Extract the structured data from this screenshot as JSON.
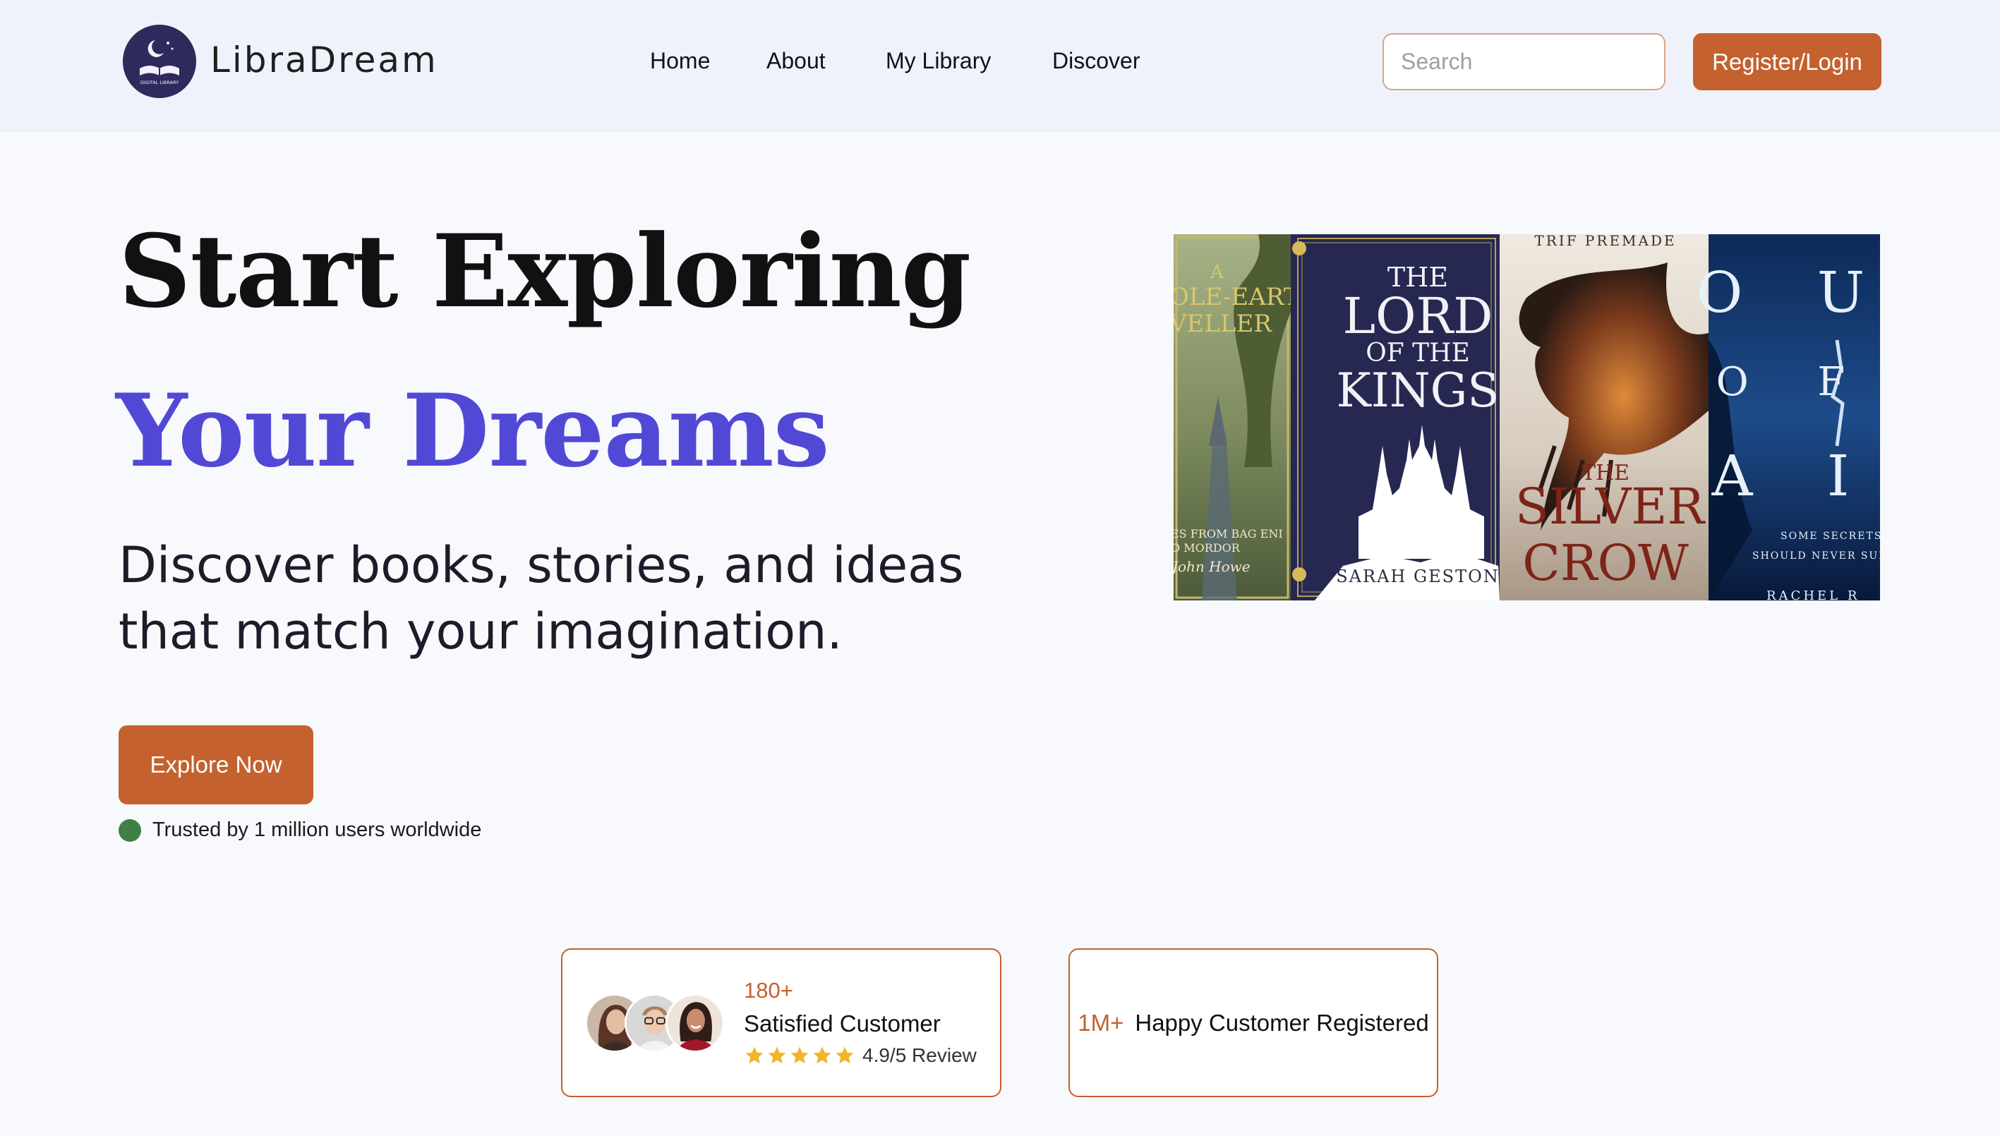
{
  "header": {
    "brand": "LibraDream",
    "logo_text": "DIGITAL LIBRARY",
    "nav": {
      "home": "Home",
      "about": "About",
      "my_library": "My Library",
      "discover": "Discover"
    },
    "search": {
      "placeholder": "Search",
      "value": ""
    },
    "login_label": "Register/Login"
  },
  "hero": {
    "line1": "Start Exploring",
    "line2": "Your Dreams",
    "subtitle": "Discover books, stories, and ideas that match your imagination.",
    "cta_label": "Explore Now",
    "trusted_text": "Trusted by 1 million users worldwide"
  },
  "banner": {
    "book1": {
      "title_lines": [
        "A",
        "OLE-EART",
        "VELLER"
      ],
      "footer_lines": [
        "ES FROM BAG ENI",
        "O MORDOR"
      ],
      "author": "John Howe"
    },
    "book2": {
      "title_the": "THE",
      "title_lord": "LORD",
      "title_of": "OF THE",
      "title_kings": "KINGS",
      "author": "SARAH GESTON"
    },
    "book3": {
      "top": "TRIF PREMADE",
      "title_the": "THE",
      "title_silver": "SILVER",
      "title_crow": "CROW"
    },
    "book4": {
      "letters_row1": "O U",
      "letters_row2": "O F",
      "letters_row3": "A I",
      "tag1": "SOME SECRETS",
      "tag2": "SHOULD NEVER SUR",
      "author": "RACHEL R"
    }
  },
  "stats": {
    "card1": {
      "count": "180+",
      "label": "Satisfied Customer",
      "rating": 4.9,
      "review": "4.9/5 Review"
    },
    "card2": {
      "count": "1M+",
      "label": "Happy Customer Registered"
    }
  },
  "colors": {
    "accent": "#c4612e",
    "brand_purple": "#5149d6",
    "header_bg": "#eff2fa",
    "page_bg": "#f7f9fc",
    "trusted_dot": "#3f7f48",
    "star": "#f2b42a"
  },
  "icons": {
    "logo": "book-moon-logo-icon",
    "status_dot": "status-dot-icon",
    "rating": "star-icon"
  }
}
